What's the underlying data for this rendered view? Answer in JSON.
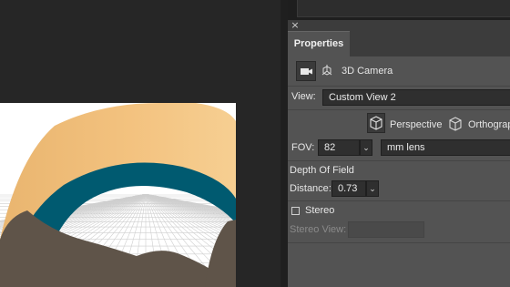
{
  "panel": {
    "tab_label": "Properties",
    "close_glyph": "×",
    "camera_section_label": "3D Camera",
    "camera_icon": "video-camera-icon",
    "scene_icon": "3d-axes-icon",
    "view": {
      "label": "View:",
      "value": "Custom View 2"
    },
    "projection": {
      "perspective_label": "Perspective",
      "orthographic_label": "Orthograp",
      "perspective_icon": "perspective-cube-icon",
      "orthographic_icon": "orthographic-cube-icon",
      "selected": "Perspective"
    },
    "fov": {
      "label": "FOV:",
      "value": "82",
      "unit_value": "mm lens"
    },
    "depth_of_field": {
      "heading": "Depth Of Field",
      "distance_label": "Distance:",
      "distance_value": "0.73"
    },
    "stereo": {
      "checkbox_label": "Stereo",
      "checked": false,
      "view_label": "Stereo View:",
      "view_value": ""
    }
  },
  "colors": {
    "panel_bg": "#535353",
    "canvas_bg": "#262626",
    "ring_inner": "#005a70",
    "ring_outer": "#f1c07f",
    "shadow_shape": "#5f5449"
  }
}
